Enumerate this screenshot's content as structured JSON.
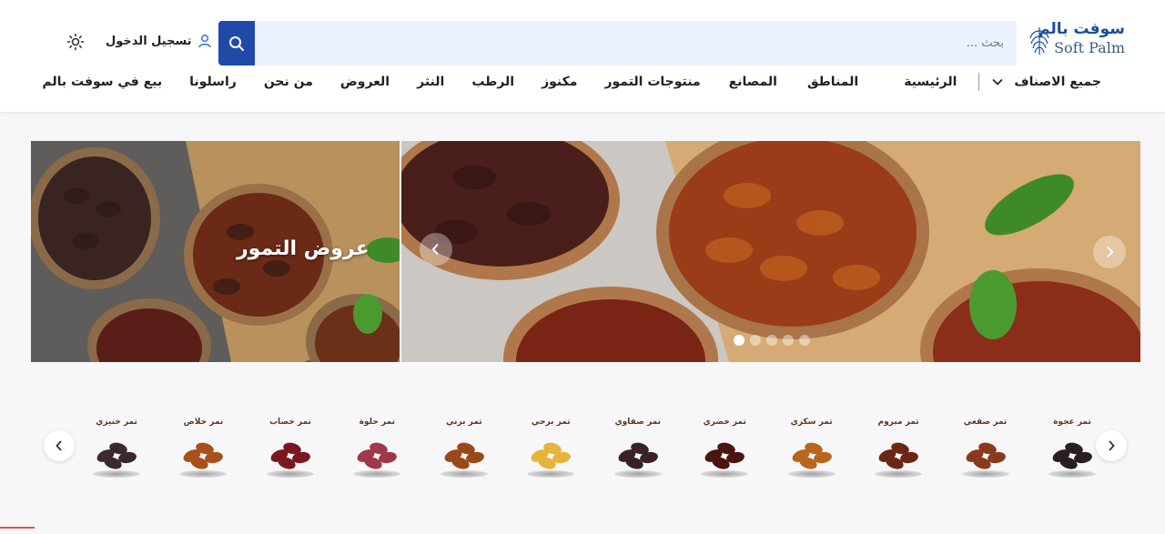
{
  "brand": {
    "name_ar": "سوفت بالم",
    "name_en": "Soft Palm"
  },
  "search": {
    "placeholder": "بحث ..."
  },
  "header": {
    "login_label": "تسجيل الدخول"
  },
  "nav": {
    "categories_label": "جميع الاصناف",
    "items": [
      "الرئيسية",
      "المناطق",
      "المصانع",
      "منتوجات التمور",
      "مكنوز",
      "الرطب",
      "النثر",
      "العروض",
      "من نحن",
      "راسلونا",
      "بيع في سوفت بالم"
    ]
  },
  "banner": {
    "title": "عروض التمور",
    "slide_count": 5,
    "active_slide": 1
  },
  "categories": [
    {
      "name": "تمر عجوة",
      "color": "#2a1f20"
    },
    {
      "name": "تمر صقعي",
      "color": "#8a3a1c"
    },
    {
      "name": "تمر مبروم",
      "color": "#6b2614"
    },
    {
      "name": "تمر سكري",
      "color": "#b8651e"
    },
    {
      "name": "تمر خضري",
      "color": "#4a1410"
    },
    {
      "name": "تمر صفاوي",
      "color": "#3a2224"
    },
    {
      "name": "تمر برحي",
      "color": "#e6b43a"
    },
    {
      "name": "تمر برني",
      "color": "#9a4a18"
    },
    {
      "name": "تمر حلوة",
      "color": "#a0384a"
    },
    {
      "name": "تمر خصاب",
      "color": "#7a1820"
    },
    {
      "name": "تمر خلاص",
      "color": "#a8501a"
    },
    {
      "name": "تمر خنيزي",
      "color": "#3a2a30"
    }
  ],
  "colors": {
    "brand_blue": "#1f4aa8",
    "search_bg": "#e9f2fd",
    "page_bg": "#f7f7f9"
  },
  "icons": {
    "search": "search-icon",
    "user": "user-icon",
    "theme": "sun-icon",
    "dropdown": "chevron-down-icon"
  }
}
